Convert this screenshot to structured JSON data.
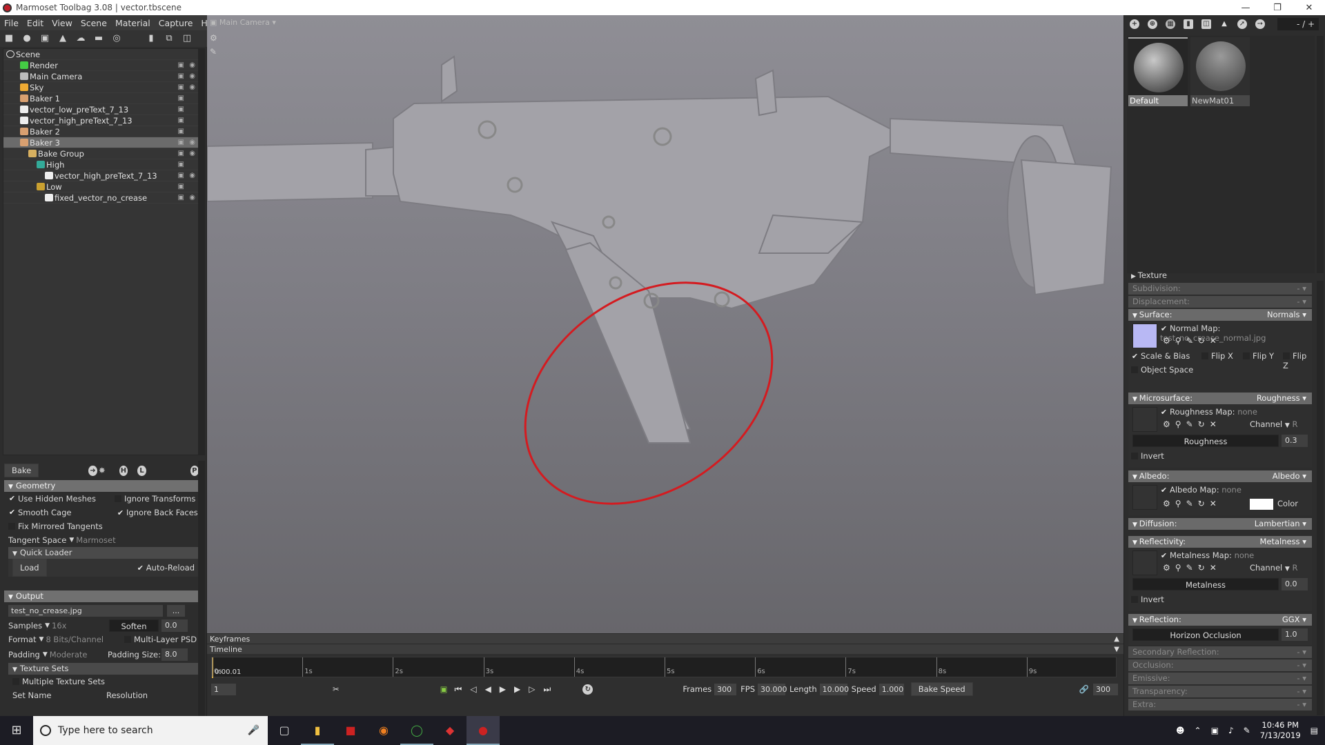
{
  "window": {
    "title": "Marmoset Toolbag 3.08  |  vector.tbscene",
    "controls": [
      "minimize",
      "restore",
      "close"
    ]
  },
  "menu": [
    "File",
    "Edit",
    "View",
    "Scene",
    "Material",
    "Capture",
    "Help"
  ],
  "toolbar": [
    "cube-icon",
    "light-icon",
    "camera-icon",
    "sky-icon",
    "turntable-icon",
    "baker-icon",
    "audio-icon",
    "folder-icon",
    "duplicate-icon",
    "trash-icon"
  ],
  "scene_tree": [
    {
      "label": "Scene",
      "depth": 0,
      "icon": "scene-icon"
    },
    {
      "label": "Render",
      "depth": 1,
      "icon": "render-icon"
    },
    {
      "label": "Main Camera",
      "depth": 1,
      "icon": "camera-icon"
    },
    {
      "label": "Sky",
      "depth": 1,
      "icon": "sky-icon"
    },
    {
      "label": "Baker 1",
      "depth": 1,
      "icon": "baker-icon"
    },
    {
      "label": "vector_low_preText_7_13",
      "depth": 1,
      "icon": "mesh-icon"
    },
    {
      "label": "vector_high_preText_7_13",
      "depth": 1,
      "icon": "mesh-icon"
    },
    {
      "label": "Baker 2",
      "depth": 1,
      "icon": "baker-icon"
    },
    {
      "label": "Baker 3",
      "depth": 1,
      "icon": "baker-icon",
      "selected": true
    },
    {
      "label": "Bake Group",
      "depth": 2,
      "icon": "folder-icon"
    },
    {
      "label": "High",
      "depth": 3,
      "icon": "high-icon"
    },
    {
      "label": "vector_high_preText_7_13",
      "depth": 4,
      "icon": "mesh-icon"
    },
    {
      "label": "Low",
      "depth": 3,
      "icon": "low-icon"
    },
    {
      "label": "fixed_vector_no_crease",
      "depth": 4,
      "icon": "mesh-icon"
    }
  ],
  "bake": {
    "button": "Bake",
    "geometry": {
      "title": "Geometry",
      "use_hidden_meshes": "Use Hidden Meshes",
      "ignore_transforms": "Ignore Transforms",
      "smooth_cage": "Smooth Cage",
      "ignore_back_faces": "Ignore Back Faces",
      "fix_mirrored": "Fix Mirrored Tangents",
      "tangent_space_label": "Tangent Space",
      "tangent_space_value": "Marmoset",
      "quick_loader": "Quick Loader",
      "load": "Load",
      "auto_reload": "Auto-Reload"
    },
    "output": {
      "title": "Output",
      "file": "test_no_crease.jpg",
      "browse": "...",
      "samples_label": "Samples",
      "samples_value": "16x",
      "soften_label": "Soften",
      "soften_value": "0.0",
      "format_label": "Format",
      "format_value": "8 Bits/Channel",
      "multilayer": "Multi-Layer PSD",
      "padding_label": "Padding",
      "padding_value": "Moderate",
      "padding_size_label": "Padding Size:",
      "padding_size_value": "8.0",
      "texture_sets": "Texture Sets",
      "multiple_sets": "Multiple Texture Sets",
      "set_name": "Set Name",
      "resolution": "Resolution"
    }
  },
  "viewport": {
    "camera": "Main Camera"
  },
  "timeline": {
    "keyframes": "Keyframes",
    "timeline": "Timeline",
    "ticks": [
      "0s",
      "1s",
      "2s",
      "3s",
      "4s",
      "5s",
      "6s",
      "7s",
      "8s",
      "9s"
    ],
    "current_time": "0:00.01",
    "frame": "1",
    "frames_label": "Frames",
    "frames": "300",
    "fps_label": "FPS",
    "fps": "30.000",
    "length_label": "Length",
    "length": "10.000",
    "speed_label": "Speed",
    "speed": "1.000",
    "bake_speed": "Bake Speed",
    "end_frame": "300"
  },
  "materials": {
    "counter": "- / +",
    "items": [
      {
        "name": "Default",
        "selected": true
      },
      {
        "name": "NewMat01"
      }
    ]
  },
  "material_props": {
    "texture": "Texture",
    "subdivision": {
      "label": "Subdivision:",
      "value": "-"
    },
    "displacement": {
      "label": "Displacement:",
      "value": "-"
    },
    "surface": {
      "label": "Surface:",
      "value": "Normals",
      "map_label": "Normal Map:",
      "map_value": "test_no_crease_normal.jpg",
      "scale_bias": "Scale & Bias",
      "flip_x": "Flip X",
      "flip_y": "Flip Y",
      "flip_z": "Flip Z",
      "object_space": "Object Space"
    },
    "microsurface": {
      "label": "Microsurface:",
      "value": "Roughness",
      "map_label": "Roughness Map:",
      "map_value": "none",
      "channel_label": "Channel",
      "channel_value": "R",
      "slider_label": "Roughness",
      "slider_value": "0.3",
      "invert": "Invert"
    },
    "albedo": {
      "label": "Albedo:",
      "value": "Albedo",
      "map_label": "Albedo Map:",
      "map_value": "none",
      "color_label": "Color"
    },
    "diffusion": {
      "label": "Diffusion:",
      "value": "Lambertian"
    },
    "reflectivity": {
      "label": "Reflectivity:",
      "value": "Metalness",
      "map_label": "Metalness Map:",
      "map_value": "none",
      "channel_label": "Channel",
      "channel_value": "R",
      "slider_label": "Metalness",
      "slider_value": "0.0",
      "invert": "Invert"
    },
    "reflection": {
      "label": "Reflection:",
      "value": "GGX",
      "slider_label": "Horizon Occlusion",
      "slider_value": "1.0"
    },
    "collapsed": [
      {
        "label": "Secondary Reflection:",
        "value": "-"
      },
      {
        "label": "Occlusion:",
        "value": "-"
      },
      {
        "label": "Emissive:",
        "value": "-"
      },
      {
        "label": "Transparency:",
        "value": "-"
      },
      {
        "label": "Extra:",
        "value": "-"
      }
    ]
  },
  "taskbar": {
    "search_placeholder": "Type here to search",
    "time": "10:46 PM",
    "date": "7/13/2019"
  }
}
